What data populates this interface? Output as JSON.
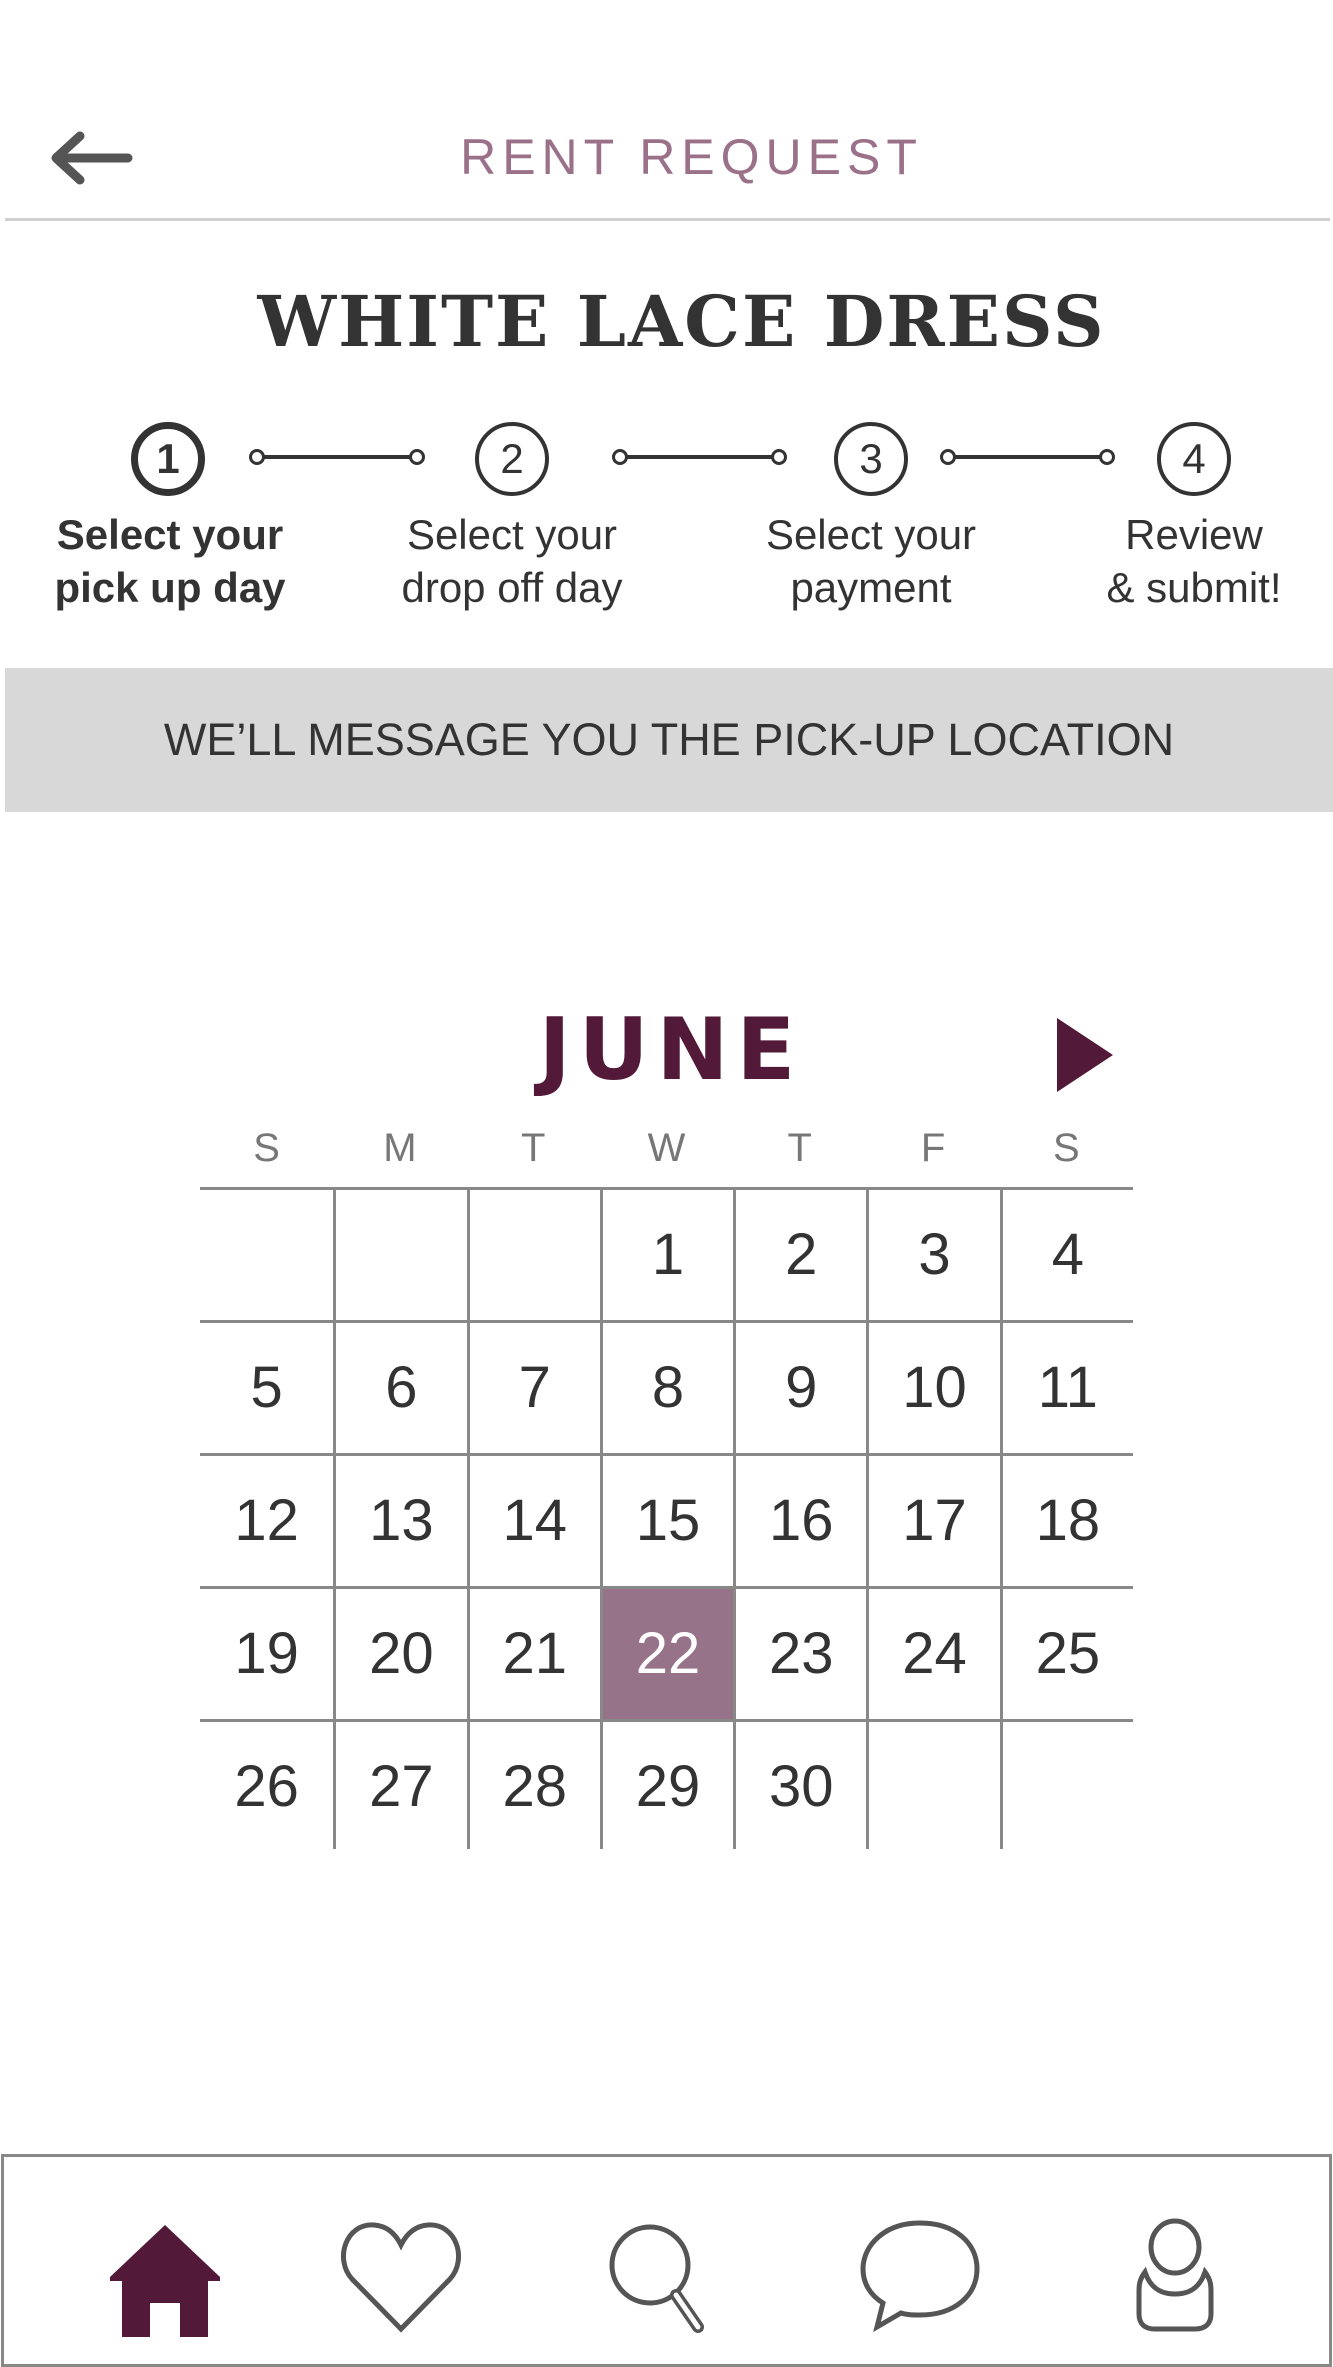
{
  "header": {
    "title": "RENT REQUEST",
    "back_icon": "arrow-left-icon"
  },
  "item": {
    "name": "WHITE LACE DRESS"
  },
  "steps": [
    {
      "number": "1",
      "label_line1": "Select your",
      "label_line2": "pick up day",
      "active": true
    },
    {
      "number": "2",
      "label_line1": "Select your",
      "label_line2": "drop off day",
      "active": false
    },
    {
      "number": "3",
      "label_line1": "Select your",
      "label_line2": "payment",
      "active": false
    },
    {
      "number": "4",
      "label_line1": "Review",
      "label_line2": "& submit!",
      "active": false
    }
  ],
  "banner": {
    "text": "WE’LL MESSAGE YOU THE PICK-UP LOCATION"
  },
  "calendar": {
    "month": "JUNE",
    "next_icon": "triangle-right-icon",
    "weekdays": [
      "S",
      "M",
      "T",
      "W",
      "T",
      "F",
      "S"
    ],
    "weeks": [
      [
        "",
        "",
        "",
        "1",
        "2",
        "3",
        "4"
      ],
      [
        "5",
        "6",
        "7",
        "8",
        "9",
        "10",
        "11"
      ],
      [
        "12",
        "13",
        "14",
        "15",
        "16",
        "17",
        "18"
      ],
      [
        "19",
        "20",
        "21",
        "22",
        "23",
        "24",
        "25"
      ],
      [
        "26",
        "27",
        "28",
        "29",
        "30",
        "",
        ""
      ]
    ],
    "selected": "22",
    "selected_color": "#977389",
    "accent_color": "#521a38"
  },
  "nav": {
    "items": [
      "home-icon",
      "heart-icon",
      "search-icon",
      "chat-icon",
      "profile-icon"
    ],
    "active": "home-icon"
  }
}
